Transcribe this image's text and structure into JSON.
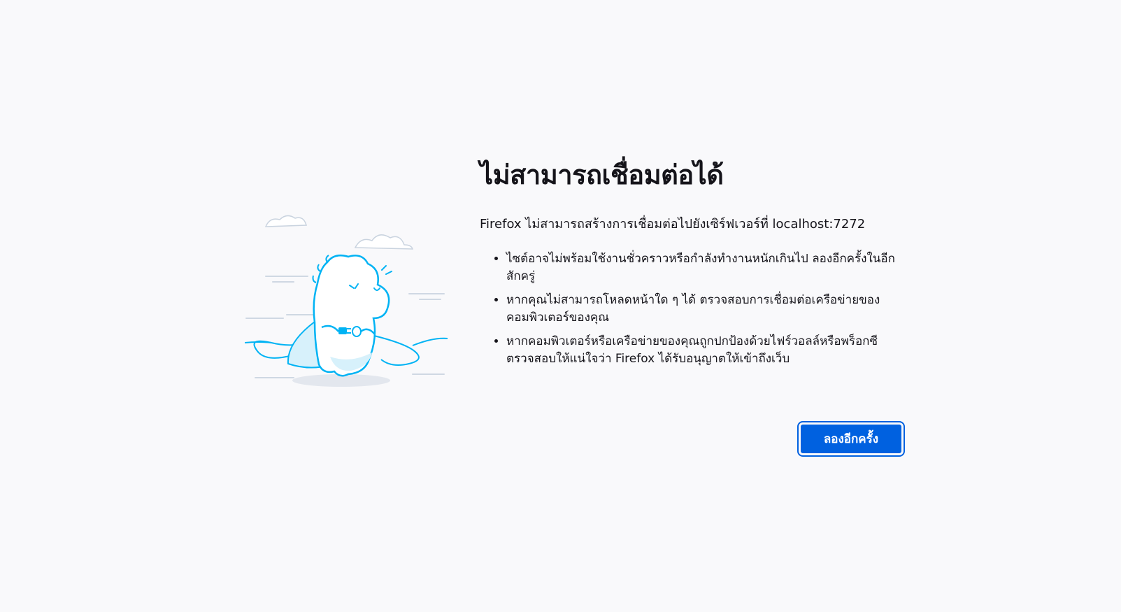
{
  "error": {
    "title": "ไม่สามารถเชื่อมต่อได้",
    "intro": "Firefox ไม่สามารถสร้างการเชื่อมต่อไปยังเซิร์ฟเวอร์ที่ localhost:7272",
    "reasons": [
      "ไซต์อาจไม่พร้อมใช้งานชั่วคราวหรือกำลังทำงานหนักเกินไป ลองอีกครั้งในอีกสักครู่",
      "หากคุณไม่สามารถโหลดหน้าใด ๆ ได้ ตรวจสอบการเชื่อมต่อเครือข่ายของคอมพิวเตอร์ของคุณ",
      "หากคอมพิวเตอร์หรือเครือข่ายของคุณถูกปกป้องด้วยไฟร์วอลล์หรือพร็อกซี ตรวจสอบให้แน่ใจว่า Firefox ได้รับอนุญาตให้เข้าถึงเว็บ"
    ],
    "retry_label": "ลองอีกครั้ง"
  },
  "illustration": {
    "icon": "dinosaur-unplugged-illustration"
  },
  "colors": {
    "background": "#f9f9fb",
    "accent": "#0061e0",
    "illustration_stroke": "#00b3f4",
    "illustration_fill": "#d7f1fb"
  }
}
